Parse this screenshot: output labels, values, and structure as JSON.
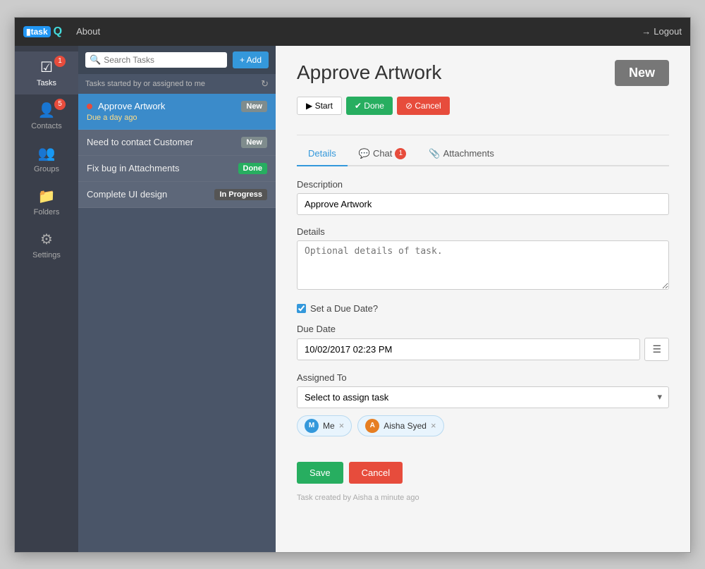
{
  "app": {
    "logo_bracket": "[",
    "logo_text": "task",
    "logo_q": "Q",
    "about_label": "About",
    "logout_label": "Logout"
  },
  "sidebar": {
    "items": [
      {
        "id": "tasks",
        "label": "Tasks",
        "icon": "☑",
        "badge": "1",
        "active": true
      },
      {
        "id": "contacts",
        "label": "Contacts",
        "icon": "👤",
        "badge": "5"
      },
      {
        "id": "groups",
        "label": "Groups",
        "icon": "👥"
      },
      {
        "id": "folders",
        "label": "Folders",
        "icon": "📁"
      },
      {
        "id": "settings",
        "label": "Settings",
        "icon": "⚙"
      }
    ]
  },
  "task_panel": {
    "search_placeholder": "Search Tasks",
    "add_button": "+ Add",
    "subheader": "Tasks started by or assigned to me",
    "tasks": [
      {
        "id": 1,
        "title": "Approve Artwork",
        "time": "Due a day ago",
        "badge": "New",
        "badge_type": "new",
        "active": true,
        "has_dot": true
      },
      {
        "id": 2,
        "title": "Need to contact Customer",
        "badge": "New",
        "badge_type": "new",
        "active": false
      },
      {
        "id": 3,
        "title": "Fix bug in Attachments",
        "badge": "Done",
        "badge_type": "done",
        "active": false
      },
      {
        "id": 4,
        "title": "Complete UI design",
        "badge": "In Progress",
        "badge_type": "inprogress",
        "active": false
      }
    ]
  },
  "content": {
    "task_title": "Approve Artwork",
    "status_badge": "New",
    "buttons": {
      "start": "▶ Start",
      "done": "✔ Done",
      "cancel": "⊘ Cancel"
    },
    "tabs": [
      {
        "id": "details",
        "label": "Details",
        "icon": "",
        "active": true
      },
      {
        "id": "chat",
        "label": "Chat",
        "icon": "💬",
        "badge": "1"
      },
      {
        "id": "attachments",
        "label": "Attachments",
        "icon": "📎"
      }
    ],
    "form": {
      "description_label": "Description",
      "description_value": "Approve Artwork",
      "details_label": "Details",
      "details_placeholder": "Optional details of task.",
      "set_due_date_label": "Set a Due Date?",
      "set_due_date_checked": true,
      "due_date_label": "Due Date",
      "due_date_value": "10/02/2017 02:23 PM",
      "assigned_to_label": "Assigned To",
      "assigned_to_placeholder": "Select to assign task",
      "assigned_users": [
        {
          "id": "me",
          "initials": "M",
          "name": "Me"
        },
        {
          "id": "aisha",
          "initials": "A",
          "name": "Aisha Syed"
        }
      ],
      "save_button": "Save",
      "cancel_button": "Cancel"
    },
    "footer_text": "Task created by Aisha a minute ago"
  }
}
